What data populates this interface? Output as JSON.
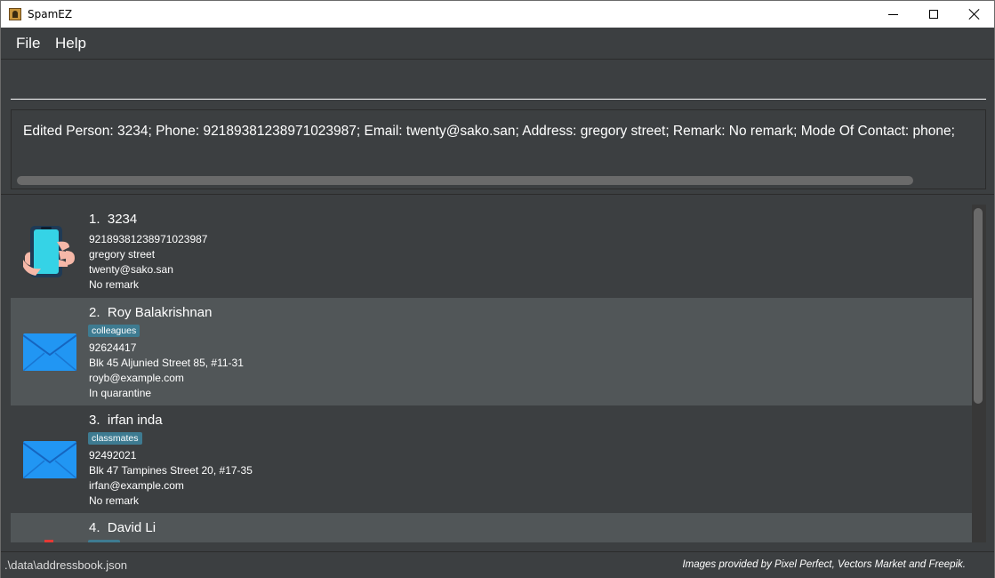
{
  "window": {
    "title": "SpamEZ"
  },
  "menu": {
    "file": "File",
    "help": "Help"
  },
  "command": {
    "value": "",
    "placeholder": ""
  },
  "result": {
    "text": "Edited Person: 3234; Phone: 92189381238971023987; Email: twenty@sako.san; Address: gregory street; Remark: No remark; Mode Of Contact: phone;"
  },
  "persons": [
    {
      "index": "1.",
      "name": "3234",
      "tag": "",
      "phone": "92189381238971023987",
      "address": "gregory street",
      "email": "twenty@sako.san",
      "remark": "No remark",
      "contact_icon": "phone-in-hand-icon"
    },
    {
      "index": "2.",
      "name": "Roy Balakrishnan",
      "tag": "colleagues",
      "phone": "92624417",
      "address": "Blk 45 Aljunied Street 85, #11-31",
      "email": "royb@example.com",
      "remark": "In quarantine",
      "contact_icon": "email-envelope-icon"
    },
    {
      "index": "3.",
      "name": "irfan inda",
      "tag": "classmates",
      "phone": "92492021",
      "address": "Blk 47 Tampines Street 20, #17-35",
      "email": "irfan@example.com",
      "remark": "No remark",
      "contact_icon": "email-envelope-icon"
    },
    {
      "index": "4.",
      "name": "David Li",
      "tag": "",
      "phone": "",
      "address": "",
      "email": "",
      "remark": "",
      "contact_icon": ""
    }
  ],
  "status": {
    "path": ".\\data\\addressbook.json",
    "credit": "Images provided by Pixel Perfect, Vectors Market and Freepik."
  },
  "colors": {
    "background": "#3c3f41",
    "card_alt": "#515658",
    "tag": "#3e7b91",
    "envelope": "#2196f3"
  }
}
